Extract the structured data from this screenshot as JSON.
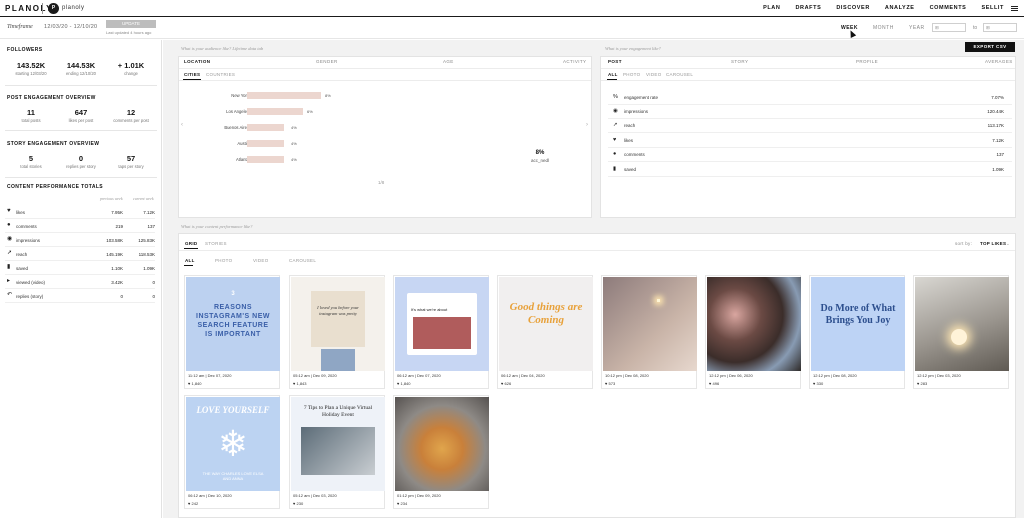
{
  "nav": {
    "brand": "PLANOLY",
    "account_initial": "P",
    "account_name": "planoly",
    "menu": [
      "PLAN",
      "DRAFTS",
      "DISCOVER",
      "ANALYZE",
      "COMMENTS",
      "SELLIT"
    ]
  },
  "timeframe": {
    "label": "Timeframe",
    "range": "12/03/20 - 12/10/20",
    "update_button": "UPDATE",
    "last_updated": "Last updated 4 hours ago",
    "periods": [
      "WEEK",
      "MONTH",
      "YEAR"
    ],
    "active_period": "WEEK",
    "to_label": "to"
  },
  "followers": {
    "title": "FOLLOWERS",
    "stats": [
      {
        "value": "143.52K",
        "label": "starting 12/03/20"
      },
      {
        "value": "144.53K",
        "label": "ending 12/10/20"
      },
      {
        "value": "+ 1.01K",
        "label": "change"
      }
    ]
  },
  "post_engagement": {
    "title": "POST ENGAGEMENT OVERVIEW",
    "stats": [
      {
        "value": "11",
        "label": "total posts"
      },
      {
        "value": "647",
        "label": "likes per post"
      },
      {
        "value": "12",
        "label": "comments per post"
      }
    ]
  },
  "story_engagement": {
    "title": "STORY ENGAGEMENT OVERVIEW",
    "stats": [
      {
        "value": "5",
        "label": "total stories"
      },
      {
        "value": "0",
        "label": "replies per story"
      },
      {
        "value": "57",
        "label": "taps per story"
      }
    ]
  },
  "content_totals": {
    "title": "CONTENT PERFORMANCE TOTALS",
    "col_previous": "previous week",
    "col_current": "current week",
    "rows": [
      {
        "icon": "heart-icon",
        "name": "likes",
        "prev": "7.95K",
        "cur": "7.12K"
      },
      {
        "icon": "comment-icon",
        "name": "comments",
        "prev": "219",
        "cur": "137"
      },
      {
        "icon": "eye-icon",
        "name": "impressions",
        "prev": "103.58K",
        "cur": "125.83K"
      },
      {
        "icon": "reach-icon",
        "name": "reach",
        "prev": "145.19K",
        "cur": "118.53K"
      },
      {
        "icon": "bookmark-icon",
        "name": "saved",
        "prev": "1.10K",
        "cur": "1.09K"
      },
      {
        "icon": "play-icon",
        "name": "viewed (video)",
        "prev": "3.42K",
        "cur": "0"
      },
      {
        "icon": "reply-icon",
        "name": "replies (story)",
        "prev": "0",
        "cur": "0"
      }
    ]
  },
  "audience": {
    "caption": "What is your audience like? Lifetime data tab",
    "headers": [
      "LOCATION",
      "GENDER",
      "AGE",
      "ACTIVITY"
    ],
    "tabs": [
      "CITIES",
      "COUNTRIES"
    ],
    "cities": [
      {
        "name": "New York",
        "pct": "8%",
        "share": 8
      },
      {
        "name": "Los Angeles",
        "pct": "6%",
        "share": 6
      },
      {
        "name": "Buenos Aires",
        "pct": "4%",
        "share": 4
      },
      {
        "name": "Austin",
        "pct": "4%",
        "share": 4
      },
      {
        "name": "Atlanta",
        "pct": "4%",
        "share": 4
      }
    ],
    "acc_value": "8%",
    "acc_label": "acc_nedl",
    "pager": "1/8"
  },
  "engagement": {
    "caption": "What is your engagement like?",
    "export": "EXPORT CSV",
    "headers": [
      "POST",
      "STORY",
      "PROFILE",
      "AVERAGES"
    ],
    "tabs": [
      "ALL",
      "PHOTO",
      "VIDEO",
      "CAROUSEL"
    ],
    "rows": [
      {
        "icon": "percent-icon",
        "name": "engagement rate",
        "value": "7.07%"
      },
      {
        "icon": "eye-icon",
        "name": "impressions",
        "value": "120.44K"
      },
      {
        "icon": "reach-icon",
        "name": "reach",
        "value": "113.17K"
      },
      {
        "icon": "heart-icon",
        "name": "likes",
        "value": "7.12K"
      },
      {
        "icon": "comment-icon",
        "name": "comments",
        "value": "137"
      },
      {
        "icon": "bookmark-icon",
        "name": "saved",
        "value": "1.09K"
      }
    ]
  },
  "content": {
    "caption": "What is your content performance like?",
    "tabs": [
      "GRID",
      "STORIES"
    ],
    "subtabs": [
      "ALL",
      "PHOTO",
      "VIDEO",
      "CAROUSEL"
    ],
    "sort_label": "sort by:",
    "sort_value": "TOP LIKES",
    "posts": [
      {
        "time": "11:12 am | Dec 07, 2020",
        "likes": "1,840"
      },
      {
        "time": "05:12 am | Dec 09, 2020",
        "likes": "1,843"
      },
      {
        "time": "06:12 am | Dec 07, 2020",
        "likes": "1,840"
      },
      {
        "time": "06:12 am | Dec 04, 2020",
        "likes": "626"
      },
      {
        "time": "10:12 pm | Dec 08, 2020",
        "likes": "573"
      },
      {
        "time": "12:12 pm | Dec 06, 2020",
        "likes": "496"
      },
      {
        "time": "12:12 pm | Dec 08, 2020",
        "likes": "330"
      },
      {
        "time": "12:12 pm | Dec 03, 2020",
        "likes": "283"
      },
      {
        "time": "06:12 am | Dec 10, 2020",
        "likes": "242"
      },
      {
        "time": "05:12 am | Dec 03, 2020",
        "likes": "230"
      },
      {
        "time": "01:12 pm | Dec 09, 2020",
        "likes": "234"
      }
    ],
    "thumb_texts": {
      "p1_title": "REASONS INSTAGRAM'S NEW SEARCH FEATURE IS IMPORTANT",
      "p1_num": "3",
      "p2_text": "I loved you before your instagram was pretty",
      "p3_text": "It's what we're about",
      "p4_text": "Good things are Coming",
      "p7_text": "Do More of What Brings You Joy",
      "p9_title": "LOVE YOURSELF",
      "p9_sub": "THE WAY CHARLES LOVE ELSA AND ANNA",
      "p10_title": "7 Tips to Plan a Unique Virtual Holiday Event"
    }
  }
}
